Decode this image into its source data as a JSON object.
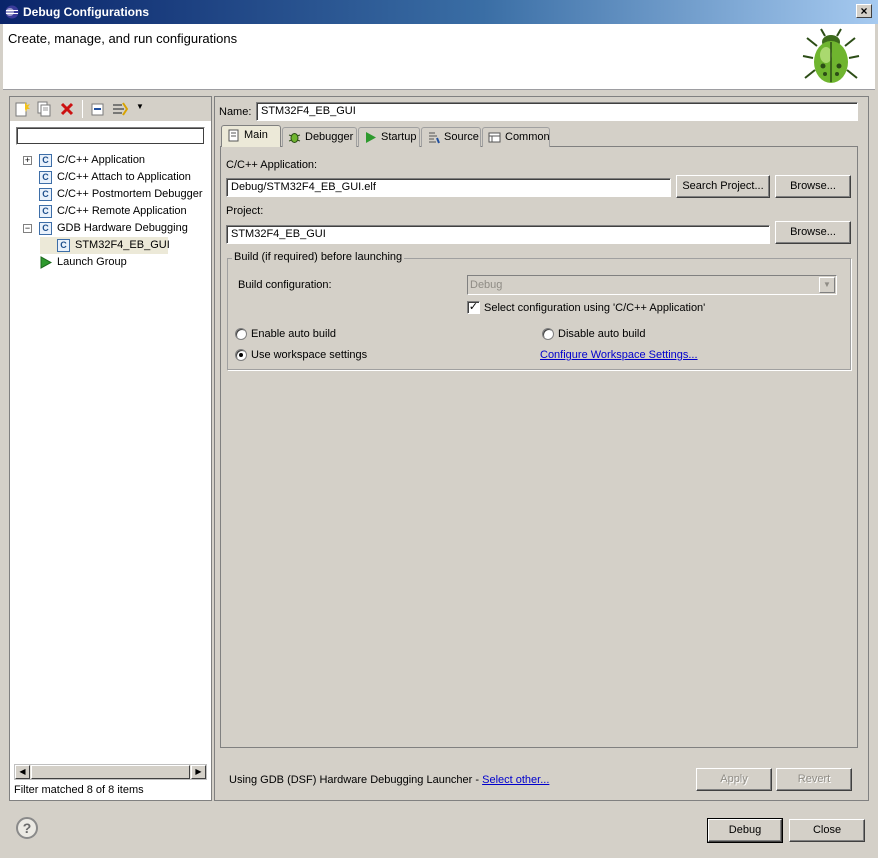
{
  "window": {
    "title": "Debug Configurations",
    "close_glyph": "×"
  },
  "banner": {
    "text": "Create, manage, and run configurations",
    "icon": "bug-icon"
  },
  "left_toolbar": {
    "icons": [
      "new-configuration-icon",
      "duplicate-icon",
      "delete-icon",
      "collapse-all-icon",
      "filter-icon",
      "dropdown-arrow-icon"
    ]
  },
  "filter": {
    "value": "",
    "status": "Filter matched 8 of 8 items"
  },
  "tree": {
    "items": [
      {
        "label": "C/C++ Application",
        "expander": "+"
      },
      {
        "label": "C/C++ Attach to Application"
      },
      {
        "label": "C/C++ Postmortem Debugger"
      },
      {
        "label": "C/C++ Remote Application"
      },
      {
        "label": "GDB Hardware Debugging",
        "expander": "−"
      },
      {
        "label": "STM32F4_EB_GUI",
        "selected": true
      },
      {
        "label": "Launch Group"
      }
    ],
    "icon_letter": "C"
  },
  "config": {
    "name_label": "Name:",
    "name_value": "STM32F4_EB_GUI",
    "tabs": [
      {
        "label": "Main",
        "active": true
      },
      {
        "label": "Debugger"
      },
      {
        "label": "Startup"
      },
      {
        "label": "Source"
      },
      {
        "label": "Common"
      }
    ],
    "main": {
      "app_label": "C/C++ Application:",
      "app_value": "Debug/STM32F4_EB_GUI.elf",
      "search_project_label": "Search Project...",
      "browse_app_label": "Browse...",
      "project_label": "Project:",
      "project_value": "STM32F4_EB_GUI",
      "browse_project_label": "Browse...",
      "build_group_label": "Build (if required) before launching",
      "build_config_label": "Build configuration:",
      "build_config_value": "Debug",
      "select_config_label": "Select configuration using 'C/C++ Application'",
      "select_config_checked": true,
      "enable_auto_build_label": "Enable auto build",
      "disable_auto_build_label": "Disable auto build",
      "use_workspace_label": "Use workspace settings",
      "configure_workspace_link": "Configure Workspace Settings...",
      "radio_selected": "use_workspace"
    },
    "launcher_text": "Using GDB (DSF) Hardware Debugging Launcher - ",
    "select_other_link": "Select other...",
    "apply_label": "Apply",
    "revert_label": "Revert"
  },
  "footer": {
    "help_glyph": "?",
    "debug_label": "Debug",
    "close_label": "Close"
  },
  "colors": {
    "titlebar_start": "#0a246a",
    "titlebar_end": "#a6caf0",
    "link": "#0000cc",
    "delete_icon": "#cc1111",
    "launch_icon": "#2e9a2e"
  }
}
